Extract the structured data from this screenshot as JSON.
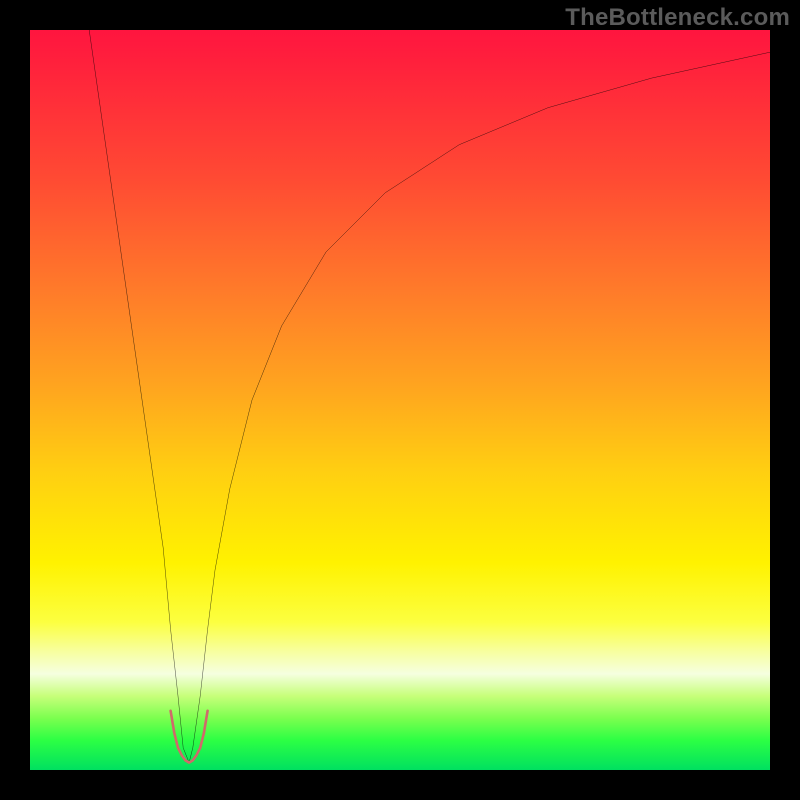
{
  "watermark": "TheBottleneck.com",
  "chart_data": {
    "type": "line",
    "title": "",
    "xlabel": "",
    "ylabel": "",
    "xlim": [
      0,
      100
    ],
    "ylim": [
      0,
      100
    ],
    "series": [
      {
        "name": "curve",
        "x": [
          8,
          10,
          12,
          14,
          16,
          18,
          19,
          20,
          20.7,
          21.5,
          22,
          23,
          24,
          25,
          27,
          30,
          34,
          40,
          48,
          58,
          70,
          84,
          100
        ],
        "y": [
          100,
          86,
          72,
          58,
          44,
          30,
          19,
          10,
          3,
          1,
          3,
          10,
          19,
          27,
          38,
          50,
          60,
          70,
          78,
          84.5,
          89.5,
          93.5,
          97
        ]
      }
    ],
    "marker": {
      "name": "u-marker",
      "color": "#cf6a6a",
      "x": [
        19,
        19.5,
        20,
        20.5,
        21,
        21.5,
        22,
        22.5,
        23,
        23.5,
        24
      ],
      "y": [
        8,
        5,
        3,
        2,
        1.3,
        1,
        1.3,
        2,
        3,
        5,
        8
      ]
    },
    "gradient_stops": [
      {
        "pos": 0.0,
        "color": "#ff153f"
      },
      {
        "pos": 0.08,
        "color": "#ff2a3a"
      },
      {
        "pos": 0.2,
        "color": "#ff4a33"
      },
      {
        "pos": 0.35,
        "color": "#ff7a2a"
      },
      {
        "pos": 0.48,
        "color": "#ffa41f"
      },
      {
        "pos": 0.6,
        "color": "#ffd011"
      },
      {
        "pos": 0.72,
        "color": "#fff200"
      },
      {
        "pos": 0.8,
        "color": "#fcff40"
      },
      {
        "pos": 0.84,
        "color": "#f7ffa0"
      },
      {
        "pos": 0.87,
        "color": "#f5ffe0"
      },
      {
        "pos": 0.9,
        "color": "#c7ff7a"
      },
      {
        "pos": 0.93,
        "color": "#7bff4f"
      },
      {
        "pos": 0.96,
        "color": "#2cff44"
      },
      {
        "pos": 1.0,
        "color": "#00e060"
      }
    ]
  }
}
